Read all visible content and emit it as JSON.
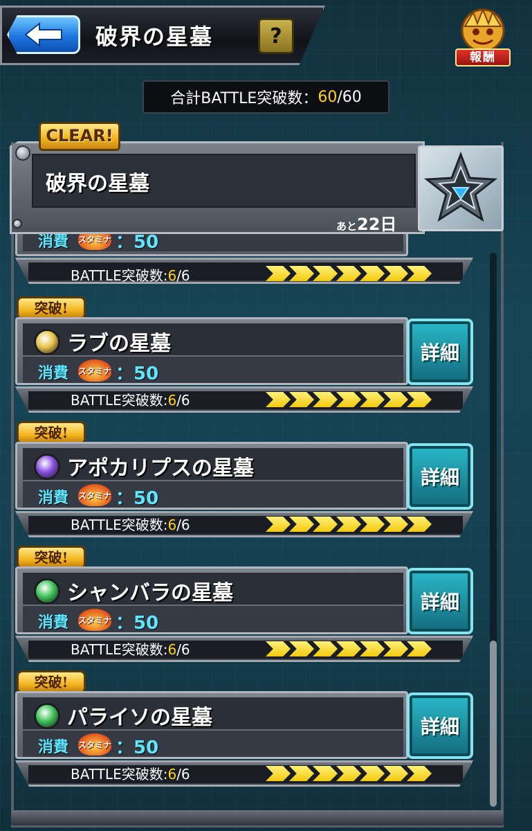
{
  "header": {
    "title": "破界の星墓",
    "help_label": "?",
    "reward_label": "報酬"
  },
  "summary": {
    "prefix": "合計BATTLE突破数：",
    "current": "60",
    "separator": "/",
    "total": "60"
  },
  "featured": {
    "clear_badge": "CLEAR!",
    "title": "破界の星墓",
    "days_prefix": "あと",
    "days_value": "22日"
  },
  "partial_card": {
    "cost_label": "消費",
    "stamina_label": "スタミナ",
    "cost_value": "：50",
    "progress_prefix": "BATTLE突破数:",
    "progress_current": "6",
    "progress_sep_total": "/6",
    "progress_fraction": 1.0
  },
  "stages": [
    {
      "badge": "突破!",
      "name": "ラブの星墓",
      "element_icon": "light-element-icon",
      "element_color": "#e8c24a",
      "cost_label": "消費",
      "stamina_label": "スタミナ",
      "cost_value": "：50",
      "detail_label": "詳細",
      "progress_prefix": "BATTLE突破数:",
      "progress_current": "6",
      "progress_sep_total": "/6",
      "progress_fraction": 1.0
    },
    {
      "badge": "突破!",
      "name": "アポカリプスの星墓",
      "element_icon": "dark-element-icon",
      "element_color": "#8a4fe0",
      "cost_label": "消費",
      "stamina_label": "スタミナ",
      "cost_value": "：50",
      "detail_label": "詳細",
      "progress_prefix": "BATTLE突破数:",
      "progress_current": "6",
      "progress_sep_total": "/6",
      "progress_fraction": 1.0
    },
    {
      "badge": "突破!",
      "name": "シャンバラの星墓",
      "element_icon": "wood-element-icon",
      "element_color": "#3fc25a",
      "cost_label": "消費",
      "stamina_label": "スタミナ",
      "cost_value": "：50",
      "detail_label": "詳細",
      "progress_prefix": "BATTLE突破数:",
      "progress_current": "6",
      "progress_sep_total": "/6",
      "progress_fraction": 1.0
    },
    {
      "badge": "突破!",
      "name": "パライソの星墓",
      "element_icon": "wood-element-icon",
      "element_color": "#3fc25a",
      "cost_label": "消費",
      "stamina_label": "スタミナ",
      "cost_value": "：50",
      "detail_label": "詳細",
      "progress_prefix": "BATTLE突破数:",
      "progress_current": "6",
      "progress_sep_total": "/6",
      "progress_fraction": 1.0
    }
  ],
  "colors": {
    "accent_yellow": "#ffd21e",
    "cost_cyan": "#5fe6ff",
    "detail_teal": "#2ab9c9"
  }
}
